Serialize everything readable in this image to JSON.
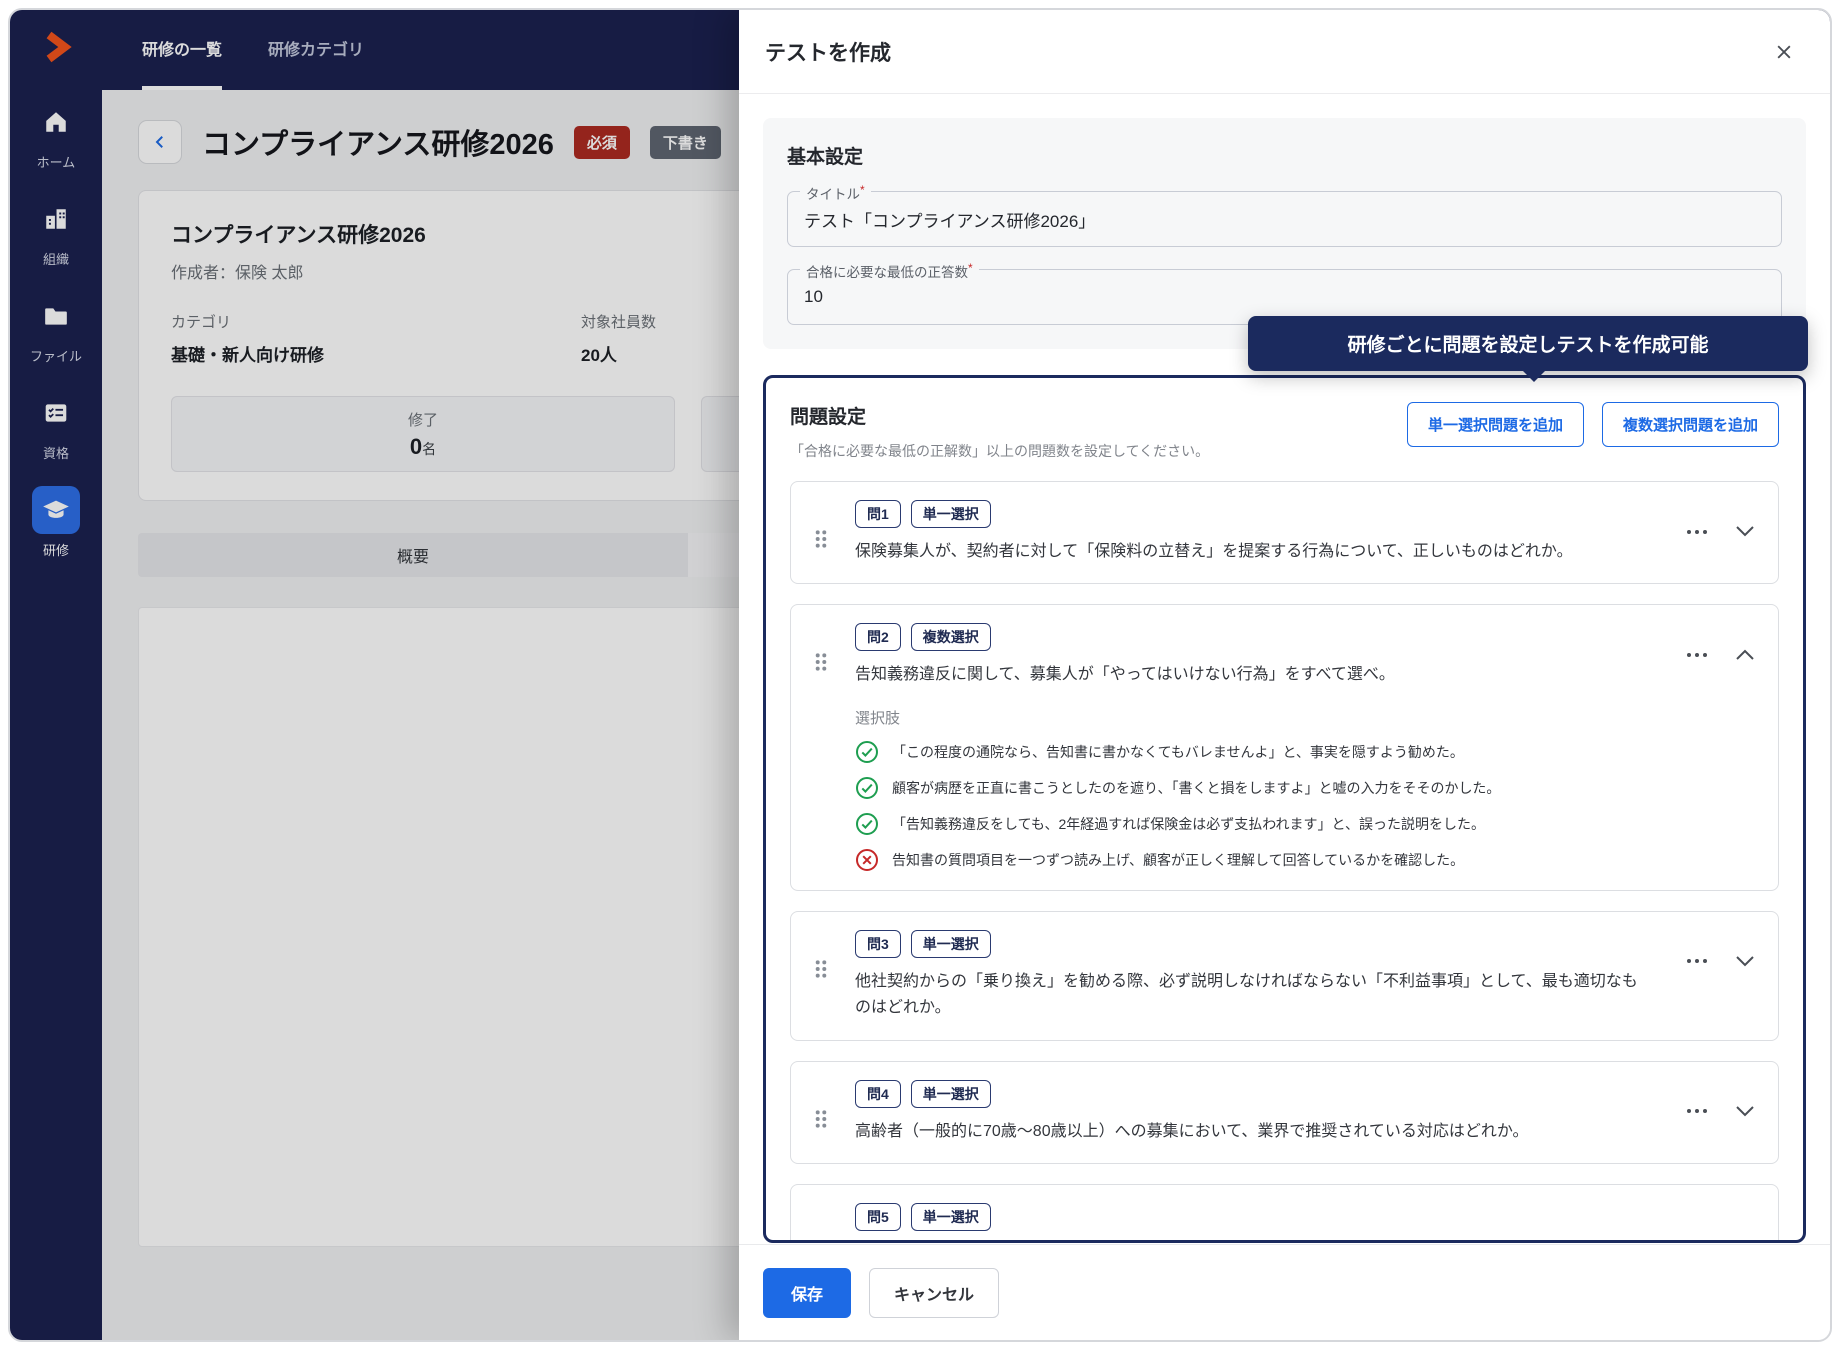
{
  "colors": {
    "navy": "#1B2150",
    "accent_blue": "#1D6AE5",
    "highlight_navy": "#1B2A5E",
    "green_check": "#1E9E50",
    "red_cross": "#C62828",
    "required_badge": "#AD2A21"
  },
  "sidebar": {
    "items": [
      {
        "label": "ホーム",
        "icon": "home-icon"
      },
      {
        "label": "組織",
        "icon": "organization-icon"
      },
      {
        "label": "ファイル",
        "icon": "folder-icon"
      },
      {
        "label": "資格",
        "icon": "certificate-icon"
      },
      {
        "label": "研修",
        "icon": "training-icon"
      }
    ]
  },
  "topnav": {
    "tabs": [
      {
        "label": "研修の一覧"
      },
      {
        "label": "研修カテゴリ"
      }
    ]
  },
  "background": {
    "title": "コンプライアンス研修2026",
    "badge_required": "必須",
    "badge_draft": "下書き",
    "card": {
      "title": "コンプライアンス研修2026",
      "author": "作成者：保険 太郎",
      "category_label": "カテゴリ",
      "category_value": "基礎・新人向け研修",
      "employees_label": "対象社員数",
      "employees_value": "20人",
      "stat_label": "修了",
      "stat_value": "0",
      "stat_unit": "名"
    },
    "tab_overview": "概要"
  },
  "modal": {
    "title": "テストを作成",
    "required_mark": "*",
    "basic": {
      "section_title": "基本設定",
      "title_field": {
        "label": "タイトル",
        "value": "テスト「コンプライアンス研修2026」"
      },
      "score_field": {
        "label": "合格に必要な最低の正答数",
        "value": "10"
      }
    },
    "tooltip": "研修ごとに問題を設定しテストを作成可能",
    "questions": {
      "section_title": "問題設定",
      "hint": "「合格に必要な最低の正解数」以上の問題数を設定してください。",
      "add_single": "単一選択問題を追加",
      "add_multi": "複数選択問題を追加",
      "choices_label": "選択肢",
      "items": [
        {
          "no": "問1",
          "type": "単一選択",
          "text": "保険募集人が、契約者に対して「保険料の立替え」を提案する行為について、正しいものはどれか。"
        },
        {
          "no": "問2",
          "type": "複数選択",
          "text": "告知義務違反に関して、募集人が「やってはいけない行為」をすべて選べ。",
          "choices": [
            {
              "correct": true,
              "text": "「この程度の通院なら、告知書に書かなくてもバレませんよ」と、事実を隠すよう勧めた。"
            },
            {
              "correct": true,
              "text": "顧客が病歴を正直に書こうとしたのを遮り、「書くと損をしますよ」と嘘の入力をそそのかした。"
            },
            {
              "correct": true,
              "text": "「告知義務違反をしても、2年経過すれば保険金は必ず支払われます」と、誤った説明をした。"
            },
            {
              "correct": false,
              "text": "告知書の質問項目を一つずつ読み上げ、顧客が正しく理解して回答しているかを確認した。"
            }
          ]
        },
        {
          "no": "問3",
          "type": "単一選択",
          "text": "他社契約からの「乗り換え」を勧める際、必ず説明しなければならない「不利益事項」として、最も適切なものはどれか。"
        },
        {
          "no": "問4",
          "type": "単一選択",
          "text": "高齢者（一般的に70歳〜80歳以上）への募集において、業界で推奨されている対応はどれか。"
        },
        {
          "no": "問5",
          "type": "単一選択",
          "text": ""
        }
      ]
    },
    "footer": {
      "save": "保存",
      "cancel": "キャンセル"
    }
  }
}
